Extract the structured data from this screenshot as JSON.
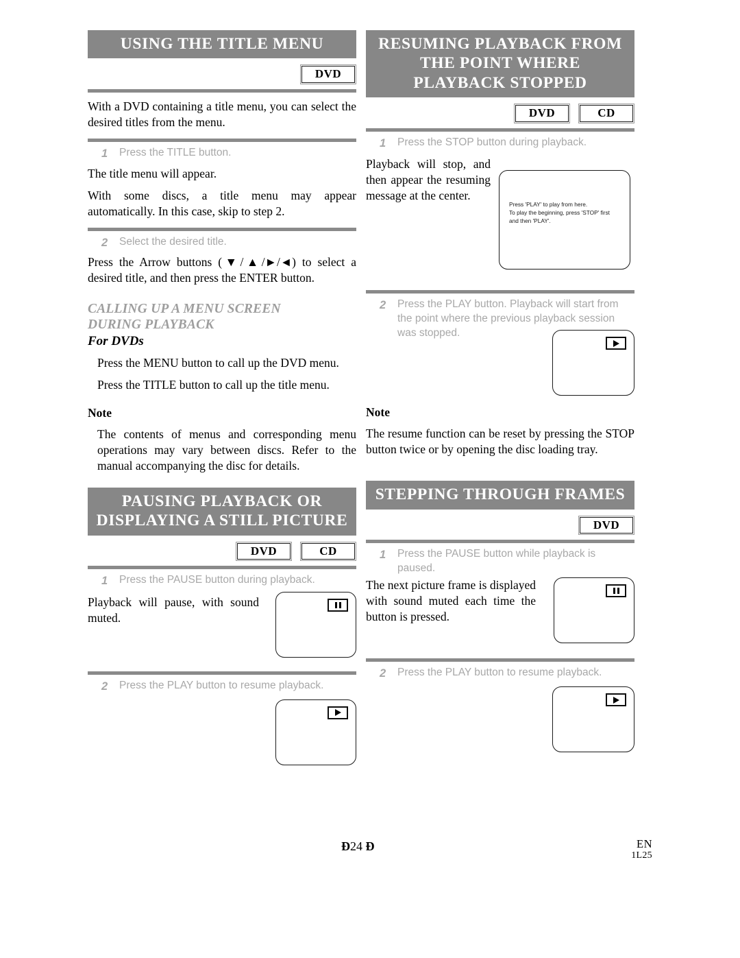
{
  "page": {
    "footer_page_prefix": "Ð",
    "footer_page_number": "24",
    "footer_page_suffix": "Ð",
    "footer_lang": "EN",
    "footer_code": "1L25",
    "banner_bg": "#878787",
    "rule_color": "#8a8a8a",
    "step_text_color": "#a8a8a8"
  },
  "left_column": {
    "section1": {
      "banner_lines": [
        "USING THE TITLE MENU"
      ],
      "badges": [
        "DVD"
      ],
      "intro": "With a DVD containing a title menu, you can select the desired titles from the menu.",
      "step1_num": "1",
      "step1_text": "Press the TITLE button.",
      "step1_body1": "The title menu will appear.",
      "step1_body2": "With some discs, a title menu may appear automatically. In this case, skip to step 2.",
      "step2_num": "2",
      "step2_text": "Select the desired title.",
      "step2_body": "Press the Arrow buttons (▼/▲/►/◄) to select a desired title, and then press the ENTER button."
    },
    "subsection": {
      "heading_line1": "CALLING UP A MENU SCREEN",
      "heading_line2": "DURING PLAYBACK",
      "subheading": "For DVDs",
      "line1": "Press the MENU button to call up the DVD menu.",
      "line2": "Press the TITLE button to call up the title menu.",
      "note_label": "Note",
      "note_text": "The contents of menus and corresponding menu operations may vary between discs. Refer to the manual accompanying the disc for details."
    },
    "section2": {
      "banner_lines": [
        "PAUSING PLAYBACK OR",
        "DISPLAYING A STILL PICTURE"
      ],
      "badges": [
        "DVD",
        "CD"
      ],
      "step1_num": "1",
      "step1_text": "Press the PAUSE button during playback.",
      "step1_body": "Playback will pause, with sound muted.",
      "step1_screen_icon": "pause-icon",
      "step2_num": "2",
      "step2_text": "Press the PLAY button to resume playback.",
      "step2_screen_icon": "play-icon"
    }
  },
  "right_column": {
    "section1": {
      "banner_lines": [
        "RESUMING PLAYBACK FROM",
        "THE POINT WHERE",
        "PLAYBACK STOPPED"
      ],
      "badges": [
        "DVD",
        "CD"
      ],
      "step1_num": "1",
      "step1_text": "Press the STOP button during playback.",
      "step1_body": "Playback will stop, and then appear the resuming message at the center.",
      "screen_message_line1": "Press 'PLAY' to play from here.",
      "screen_message_line2": "To play the beginning, press 'STOP' first",
      "screen_message_line3": "and then 'PLAY'.",
      "step2_num": "2",
      "step2_text": "Press the PLAY button. Playback will start from the point where the previous playback session was stopped.",
      "step2_screen_icon": "play-icon",
      "note_label": "Note",
      "note_text": "The resume function can be reset by pressing the STOP button twice or by opening the disc loading tray."
    },
    "section2": {
      "banner_lines": [
        "STEPPING THROUGH FRAMES"
      ],
      "badges": [
        "DVD"
      ],
      "step1_num": "1",
      "step1_text": "Press the PAUSE button while playback is paused.",
      "step1_body": "The next picture frame is displayed with sound muted each time the button is pressed.",
      "step1_screen_icon": "pause-icon",
      "step2_num": "2",
      "step2_text": "Press the PLAY button to resume playback.",
      "step2_screen_icon": "play-icon"
    }
  }
}
